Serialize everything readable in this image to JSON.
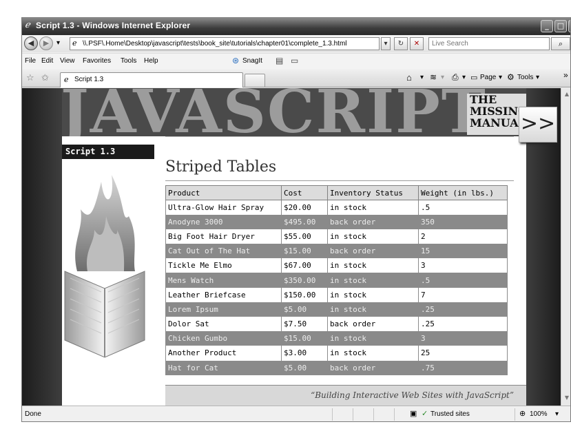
{
  "window": {
    "title": "Script 1.3 - Windows Internet Explorer",
    "ie_icon": "ie-icon",
    "buttons": [
      "_",
      "□",
      "X"
    ]
  },
  "addressbar": {
    "back_icon": "◀",
    "forward_icon": "▶",
    "url": "\\\\.PSF\\.Home\\Desktop\\javascript\\tests\\book_site\\tutorials\\chapter01\\complete_1.3.html",
    "dropdown": "▾",
    "refresh": "↻",
    "stop": "✕",
    "search_placeholder": "Live Search",
    "search_icon": "⌕"
  },
  "menubar": {
    "items": [
      "File",
      "Edit",
      "View",
      "Favorites",
      "Tools",
      "Help"
    ],
    "snagit_label": "SnagIt"
  },
  "tabbar": {
    "tab_label": "Script 1.3",
    "home_icon": "⌂",
    "feeds_icon": "≋",
    "print_icon": "⎙",
    "page_label": "Page",
    "tools_label": "Tools",
    "overflow": "»"
  },
  "page": {
    "banner_text": "JAVASCRIPT",
    "badge_lines": [
      "THE",
      "MISSING",
      "MANUAL"
    ],
    "next_arrow": ">>",
    "side_label": "Script 1.3",
    "heading": "Striped Tables",
    "table": {
      "headers": [
        "Product",
        "Cost",
        "Inventory Status",
        "Weight (in lbs.)"
      ],
      "rows": [
        [
          "Ultra-Glow Hair Spray",
          "$20.00",
          "in stock",
          ".5"
        ],
        [
          "Anodyne 3000",
          "$495.00",
          "back order",
          "350"
        ],
        [
          "Big Foot Hair Dryer",
          "$55.00",
          "in stock",
          "2"
        ],
        [
          "Cat Out of The Hat",
          "$15.00",
          "back order",
          "15"
        ],
        [
          "Tickle Me Elmo",
          "$67.00",
          "in stock",
          "3"
        ],
        [
          "Mens Watch",
          "$350.00",
          "in stock",
          ".5"
        ],
        [
          "Leather Briefcase",
          "$150.00",
          "in stock",
          "7"
        ],
        [
          "Lorem Ipsum",
          "$5.00",
          "in stock",
          ".25"
        ],
        [
          "Dolor Sat",
          "$7.50",
          "back order",
          ".25"
        ],
        [
          "Chicken Gumbo",
          "$15.00",
          "in stock",
          "3"
        ],
        [
          "Another Product",
          "$3.00",
          "in stock",
          "25"
        ],
        [
          "Hat for Cat",
          "$5.00",
          "back order",
          ".75"
        ]
      ]
    },
    "footer": "“Building Interactive Web Sites with JavaScript”"
  },
  "statusbar": {
    "status": "Done",
    "zone": "Trusted sites",
    "zoom": "100%"
  }
}
